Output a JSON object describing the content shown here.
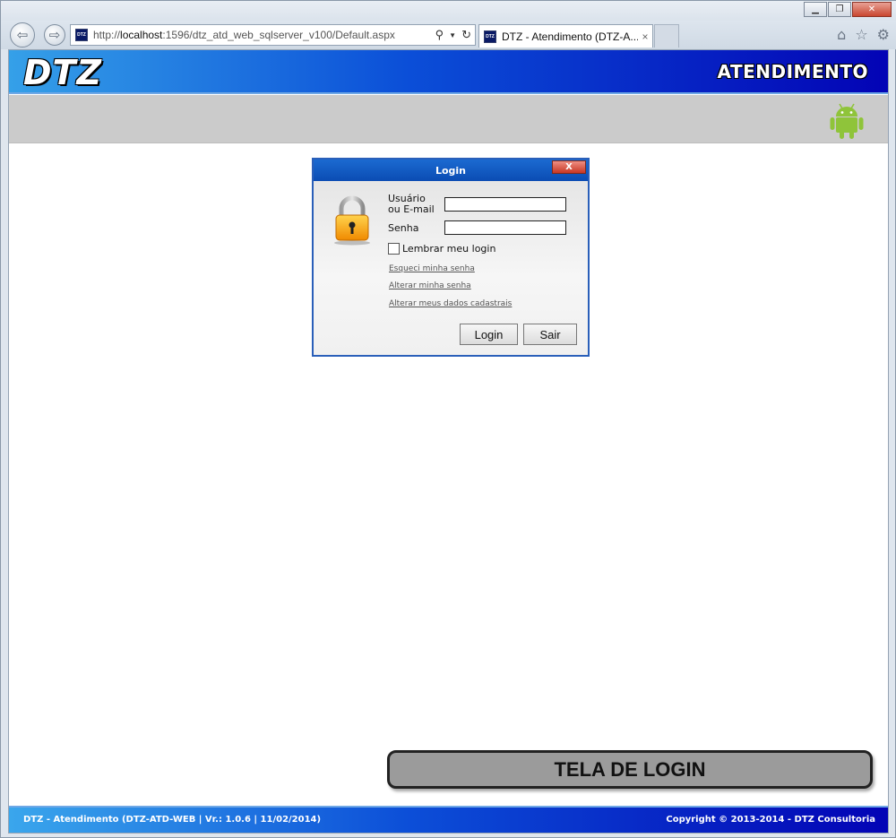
{
  "browser": {
    "address_url_prefix": "http://",
    "address_url_host": "localhost",
    "address_url_rest": ":1596/dtz_atd_web_sqlserver_v100/Default.aspx",
    "tab_title": "DTZ - Atendimento (DTZ-A...",
    "tab_close": "×",
    "favicon_text": "DTZ",
    "window_controls": [
      "minimize",
      "maximize",
      "close"
    ]
  },
  "header": {
    "logo": "DTZ",
    "title": "ATENDIMENTO",
    "android_icon": "android-icon"
  },
  "login_dialog": {
    "title": "Login",
    "close_label": "X",
    "username_label_line1": "Usuário",
    "username_label_line2": "ou E-mail",
    "username_value": "",
    "password_label": "Senha",
    "password_value": "",
    "remember_label": "Lembrar meu login",
    "remember_checked": false,
    "links": {
      "forgot_password": "Esqueci minha senha",
      "change_password": "Alterar minha senha",
      "change_details": "Alterar meus dados cadastrais"
    },
    "login_button": "Login",
    "exit_button": "Sair"
  },
  "caption": "TELA DE LOGIN",
  "footer": {
    "left_text": "DTZ - Atendimento (DTZ-ATD-WEB | Vr.: 1.0.6 | 11/02/2014)",
    "right_text": "Copyright © 2013-2014 - DTZ Consultoria"
  },
  "colors": {
    "header_blue_start": "#35a0e8",
    "header_blue_end": "#0303b5",
    "subbar_gray": "#cbcbcb",
    "dialog_title_blue": "#0b4cb3",
    "caption_gray": "#9b9b9b"
  }
}
